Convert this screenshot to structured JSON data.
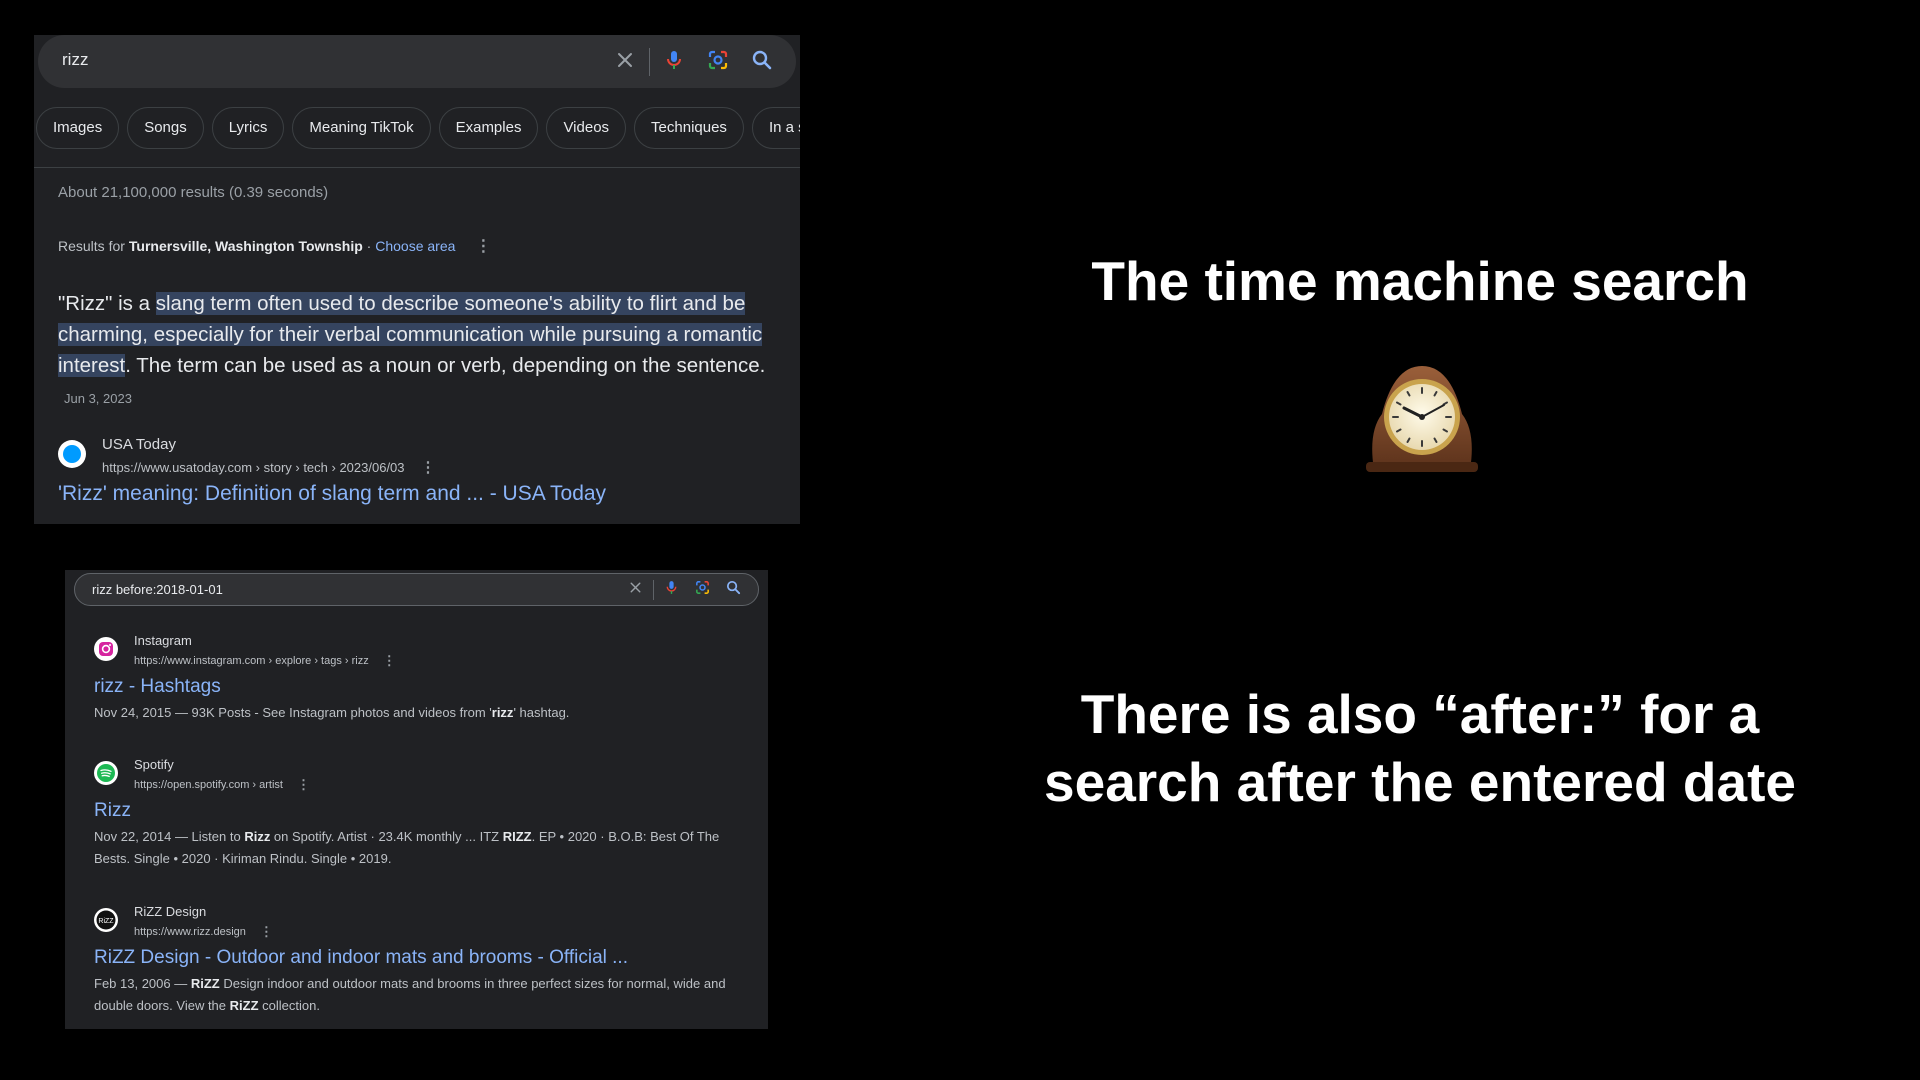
{
  "top_search": {
    "query": "rizz",
    "chips": [
      "Images",
      "Songs",
      "Lyrics",
      "Meaning TikTok",
      "Examples",
      "Videos",
      "Techniques",
      "In a se"
    ],
    "stats": "About 21,100,000 results (0.39 seconds)",
    "location_prefix": "Results for",
    "location": "Turnersville, Washington Township",
    "location_sep": " · ",
    "choose_area": "Choose area",
    "snippet": {
      "part1": "\"Rizz\" is a ",
      "highlight": "slang term often used to describe someone's ability to flirt and be charming, especially for their verbal communication while pursuing a romantic interest",
      "part2": ". The term can be used as a noun or verb, depending on the sentence.",
      "date": "Jun 3, 2023"
    },
    "source": {
      "name": "USA Today",
      "url": "https://www.usatoday.com › story › tech › 2023/06/03",
      "title": "'Rizz' meaning: Definition of slang term and ... - USA Today"
    }
  },
  "bottom_search": {
    "query": "rizz before:2018-01-01",
    "results": [
      {
        "site": "Instagram",
        "url": "https://www.instagram.com › explore › tags › rizz",
        "title": "rizz - Hashtags",
        "desc_a": "Nov 24, 2015 — 93K Posts - See Instagram photos and videos from '",
        "desc_b": "rizz",
        "desc_c": "' hashtag."
      },
      {
        "site": "Spotify",
        "url": "https://open.spotify.com › artist",
        "title": "Rizz",
        "desc_a": "Nov 22, 2014 — Listen to ",
        "desc_b": "Rizz",
        "desc_c": " on Spotify. Artist · 23.4K monthly ... ITZ ",
        "desc_d": "RIZZ",
        "desc_e": ". EP • 2020 · B.O.B: Best Of The Bests. Single • 2020 · Kiriman Rindu. Single • 2019."
      },
      {
        "site": "RiZZ Design",
        "url": "https://www.rizz.design",
        "title": "RiZZ Design - Outdoor and indoor mats and brooms - Official ...",
        "desc_a": "Feb 13, 2006 — ",
        "desc_b": "RiZZ",
        "desc_c": " Design indoor and outdoor mats and brooms in three perfect sizes for normal, wide and double doors. View the ",
        "desc_d": "RiZZ",
        "desc_e": " collection."
      }
    ]
  },
  "slide": {
    "heading": "The time machine search",
    "subheading": "There is also “after:” for a search after the entered date"
  },
  "icons": {
    "clear": "close-icon",
    "voice": "microphone-icon",
    "lens": "camera-lens-icon",
    "search": "search-icon",
    "decor": "mantelpiece-clock-icon"
  },
  "colors": {
    "page_bg": "#000000",
    "panel_bg": "#202124",
    "link": "#8ab4f8",
    "highlight": "#35445f"
  }
}
